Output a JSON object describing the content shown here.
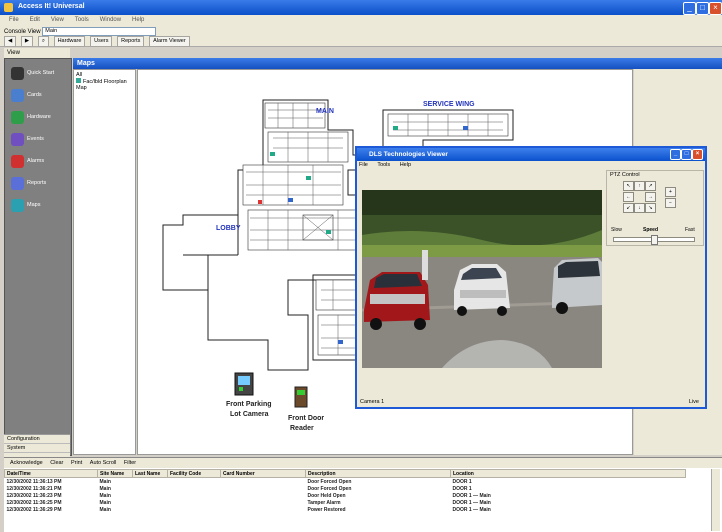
{
  "window": {
    "title": "Access It! Universal"
  },
  "menu": [
    "File",
    "Edit",
    "View",
    "Tools",
    "Window",
    "Help"
  ],
  "toolbar": {
    "console_label": "Console View",
    "console_value": "Main",
    "buttons": [
      "Hardware",
      "Users",
      "Reports",
      "Alarm Viewer"
    ]
  },
  "nav": {
    "header": "View",
    "items": [
      "Quick Start",
      "Cards",
      "Hardware",
      "Events",
      "Alarms",
      "Reports",
      "Maps"
    ],
    "bottom": [
      "Configuration",
      "System"
    ]
  },
  "maps": {
    "header": "Maps",
    "tree_root": "All",
    "tree_item": "Fac/lbld Floorplan Map",
    "labels": {
      "camera": [
        "Front Parking",
        "Lot Camera"
      ],
      "reader": [
        "Front Door",
        "Reader"
      ],
      "wing_top": "MAIN",
      "wing_right": "SERVICE WING",
      "wing_left": "LOBBY"
    }
  },
  "viewer": {
    "title": "DLS Technologies Viewer",
    "menu": [
      "File",
      "Tools",
      "Help"
    ],
    "ptz_title": "PTZ Control",
    "speed_label": "Speed",
    "speed_min": "Slow",
    "speed_max": "Fast",
    "status_left": "Camera 1",
    "status_right": "Live",
    "slider_level": 0.5
  },
  "events": {
    "toolbar": [
      "Acknowledge",
      "Clear",
      "Print",
      "Auto Scroll",
      "Filter"
    ],
    "columns": [
      "Date/Time",
      "Site Name",
      "Last Name",
      "Facility Code",
      "Card Number",
      "Description",
      "Location"
    ],
    "rows": [
      [
        "12/30/2002 11:36:13 PM",
        "Main",
        "",
        "",
        "",
        "Door Forced Open",
        "DOOR 1"
      ],
      [
        "12/30/2002 11:36:21 PM",
        "Main",
        "",
        "",
        "",
        "Door Forced Open",
        "DOOR 1"
      ],
      [
        "12/30/2002 11:36:23 PM",
        "Main",
        "",
        "",
        "",
        "Door Held Open",
        "DOOR 1 — Main"
      ],
      [
        "12/30/2002 11:36:25 PM",
        "Main",
        "",
        "",
        "",
        "Tamper Alarm",
        "DOOR 1 — Main"
      ],
      [
        "12/30/2002 11:36:29 PM",
        "Main",
        "",
        "",
        "",
        "Power Restored",
        "DOOR 1 — Main"
      ]
    ]
  },
  "colors": {
    "titlebar": "#0a4fc9",
    "nav_bg": "#808080",
    "window_bg": "#ece9d8",
    "icons": [
      "#333333",
      "#4a7fd0",
      "#2f9e4a",
      "#7050c0",
      "#d03030",
      "#5a6fd8",
      "#2aa0b0"
    ]
  }
}
